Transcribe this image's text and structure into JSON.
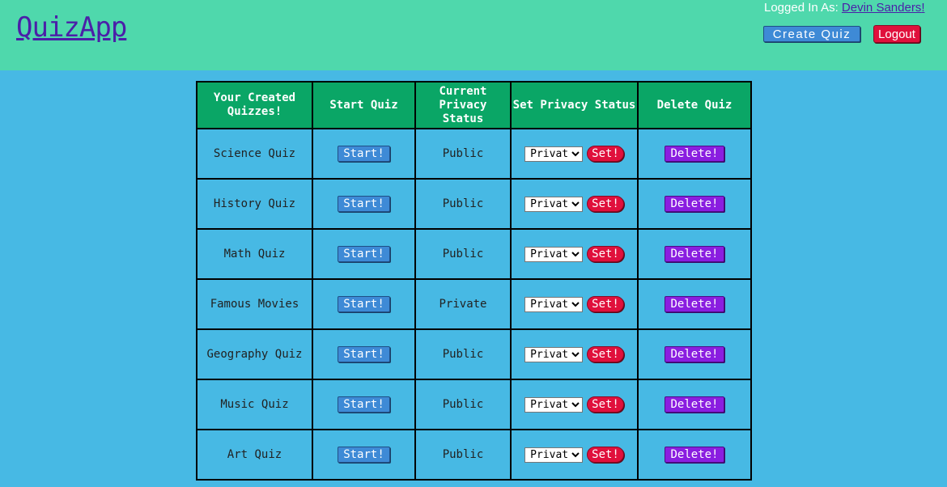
{
  "header": {
    "app_title": "QuizApp",
    "logged_in_label": "Logged In As: ",
    "user_name": "Devin Sanders",
    "user_suffix": "!",
    "create_quiz_label": "Create Quiz",
    "logout_label": "Logout"
  },
  "table": {
    "headers": [
      "Your Created Quizzes!",
      "Start Quiz",
      "Current Privacy Status",
      "Set Privacy Status",
      "Delete Quiz"
    ],
    "rows": [
      {
        "name": "Science Quiz",
        "start": "Start!",
        "status": "Public",
        "select_value": "Private",
        "set": "Set!",
        "delete": "Delete!"
      },
      {
        "name": "History Quiz",
        "start": "Start!",
        "status": "Public",
        "select_value": "Private",
        "set": "Set!",
        "delete": "Delete!"
      },
      {
        "name": "Math Quiz",
        "start": "Start!",
        "status": "Public",
        "select_value": "Private",
        "set": "Set!",
        "delete": "Delete!"
      },
      {
        "name": "Famous Movies",
        "start": "Start!",
        "status": "Private",
        "select_value": "Private",
        "set": "Set!",
        "delete": "Delete!"
      },
      {
        "name": "Geography Quiz",
        "start": "Start!",
        "status": "Public",
        "select_value": "Private",
        "set": "Set!",
        "delete": "Delete!"
      },
      {
        "name": "Music Quiz",
        "start": "Start!",
        "status": "Public",
        "select_value": "Private",
        "set": "Set!",
        "delete": "Delete!"
      },
      {
        "name": "Art Quiz",
        "start": "Start!",
        "status": "Public",
        "select_value": "Private",
        "set": "Set!",
        "delete": "Delete!"
      }
    ]
  },
  "colors": {
    "background": "#47b9e4",
    "header_bg": "#4fd8ac",
    "table_header_bg": "#0aa666",
    "start_button": "#3e8ad6",
    "set_button": "#e0103c",
    "delete_button": "#8a1ee0",
    "title_link": "#4b1fa8"
  }
}
